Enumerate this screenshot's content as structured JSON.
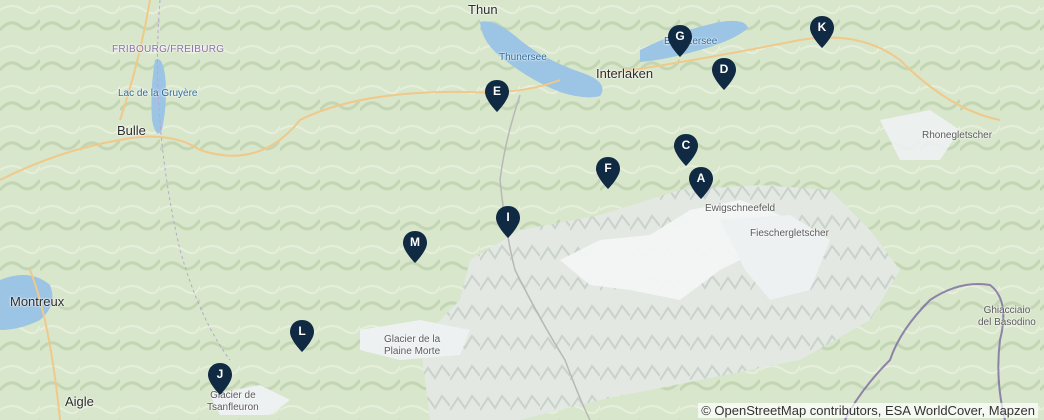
{
  "places": {
    "thun": "Thun",
    "thunersee": "Thunersee",
    "interlaken": "Interlaken",
    "brienzersee": "Brienzersee",
    "fribourg": "FRIBOURG/FREIBURG",
    "lac_gruyere": "Lac de la Gruyère",
    "bulle": "Bulle",
    "montreux": "Montreux",
    "aigle": "Aigle",
    "glacier_tsanfleuron_1": "Glacier de",
    "glacier_tsanfleuron_2": "Tsanfleuron",
    "glacier_plaine_morte_1": "Glacier de la",
    "glacier_plaine_morte_2": "Plaine Morte",
    "ewigschneefeld": "Ewigschneefeld",
    "fieschergletscher": "Fieschergletscher",
    "rhonegletscher": "Rhonegletscher",
    "ghiacciaio_1": "Ghiacciaio",
    "ghiacciaio_2": "del Basodino"
  },
  "markers": [
    {
      "letter": "A"
    },
    {
      "letter": "C"
    },
    {
      "letter": "D"
    },
    {
      "letter": "E"
    },
    {
      "letter": "F"
    },
    {
      "letter": "G"
    },
    {
      "letter": "I"
    },
    {
      "letter": "J"
    },
    {
      "letter": "K"
    },
    {
      "letter": "L"
    },
    {
      "letter": "M"
    }
  ],
  "colors": {
    "marker": "#102a43",
    "water": "#9cc4e4",
    "glacier": "#f3f5f6",
    "border": "#7a6aa0",
    "terrain": "#d9e6cc"
  },
  "attribution": "© OpenStreetMap contributors, ESA WorldCover, Mapzen"
}
